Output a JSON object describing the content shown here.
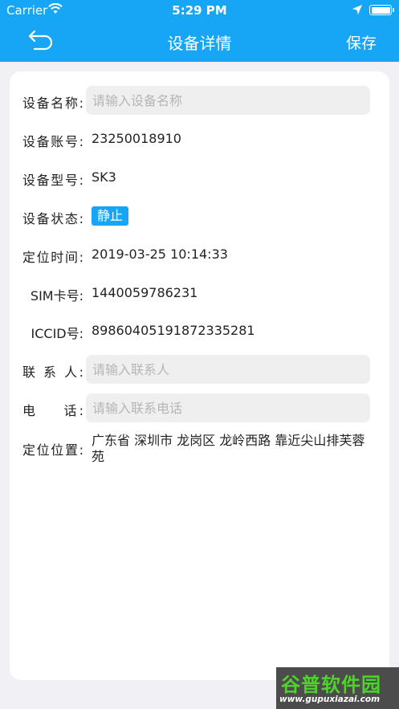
{
  "status_bar": {
    "carrier": "Carrier",
    "time": "5:29 PM"
  },
  "nav": {
    "title": "设备详情",
    "save_label": "保存",
    "back_icon": "back-arrow-icon"
  },
  "colors": {
    "primary": "#16a6f5",
    "background": "#f0f0f5",
    "input_bg": "#efefef"
  },
  "form": {
    "name_label": "设备名称:",
    "name_placeholder": "请输入设备名称",
    "account_label": "设备账号:",
    "account_value": "23250018910",
    "model_label": "设备型号:",
    "model_value": "SK3",
    "state_label": "设备状态:",
    "state_value": "静止",
    "time_label": "定位时间:",
    "time_value": "2019-03-25 10:14:33",
    "sim_label": "SIM卡号:",
    "sim_value": "1440059786231",
    "iccid_label": "ICCID号:",
    "iccid_value": "89860405191872335281",
    "contact_label": "联 系 人:",
    "contact_placeholder": "请输入联系人",
    "phone_label": "电    话:",
    "phone_placeholder": "请输入联系电话",
    "location_label": "定位位置:",
    "location_value": "广东省 深圳市 龙岗区 龙岭西路 靠近尖山排芙蓉苑"
  },
  "watermark": {
    "name": "谷普软件园",
    "url": "www.gupuxiazai.com"
  }
}
